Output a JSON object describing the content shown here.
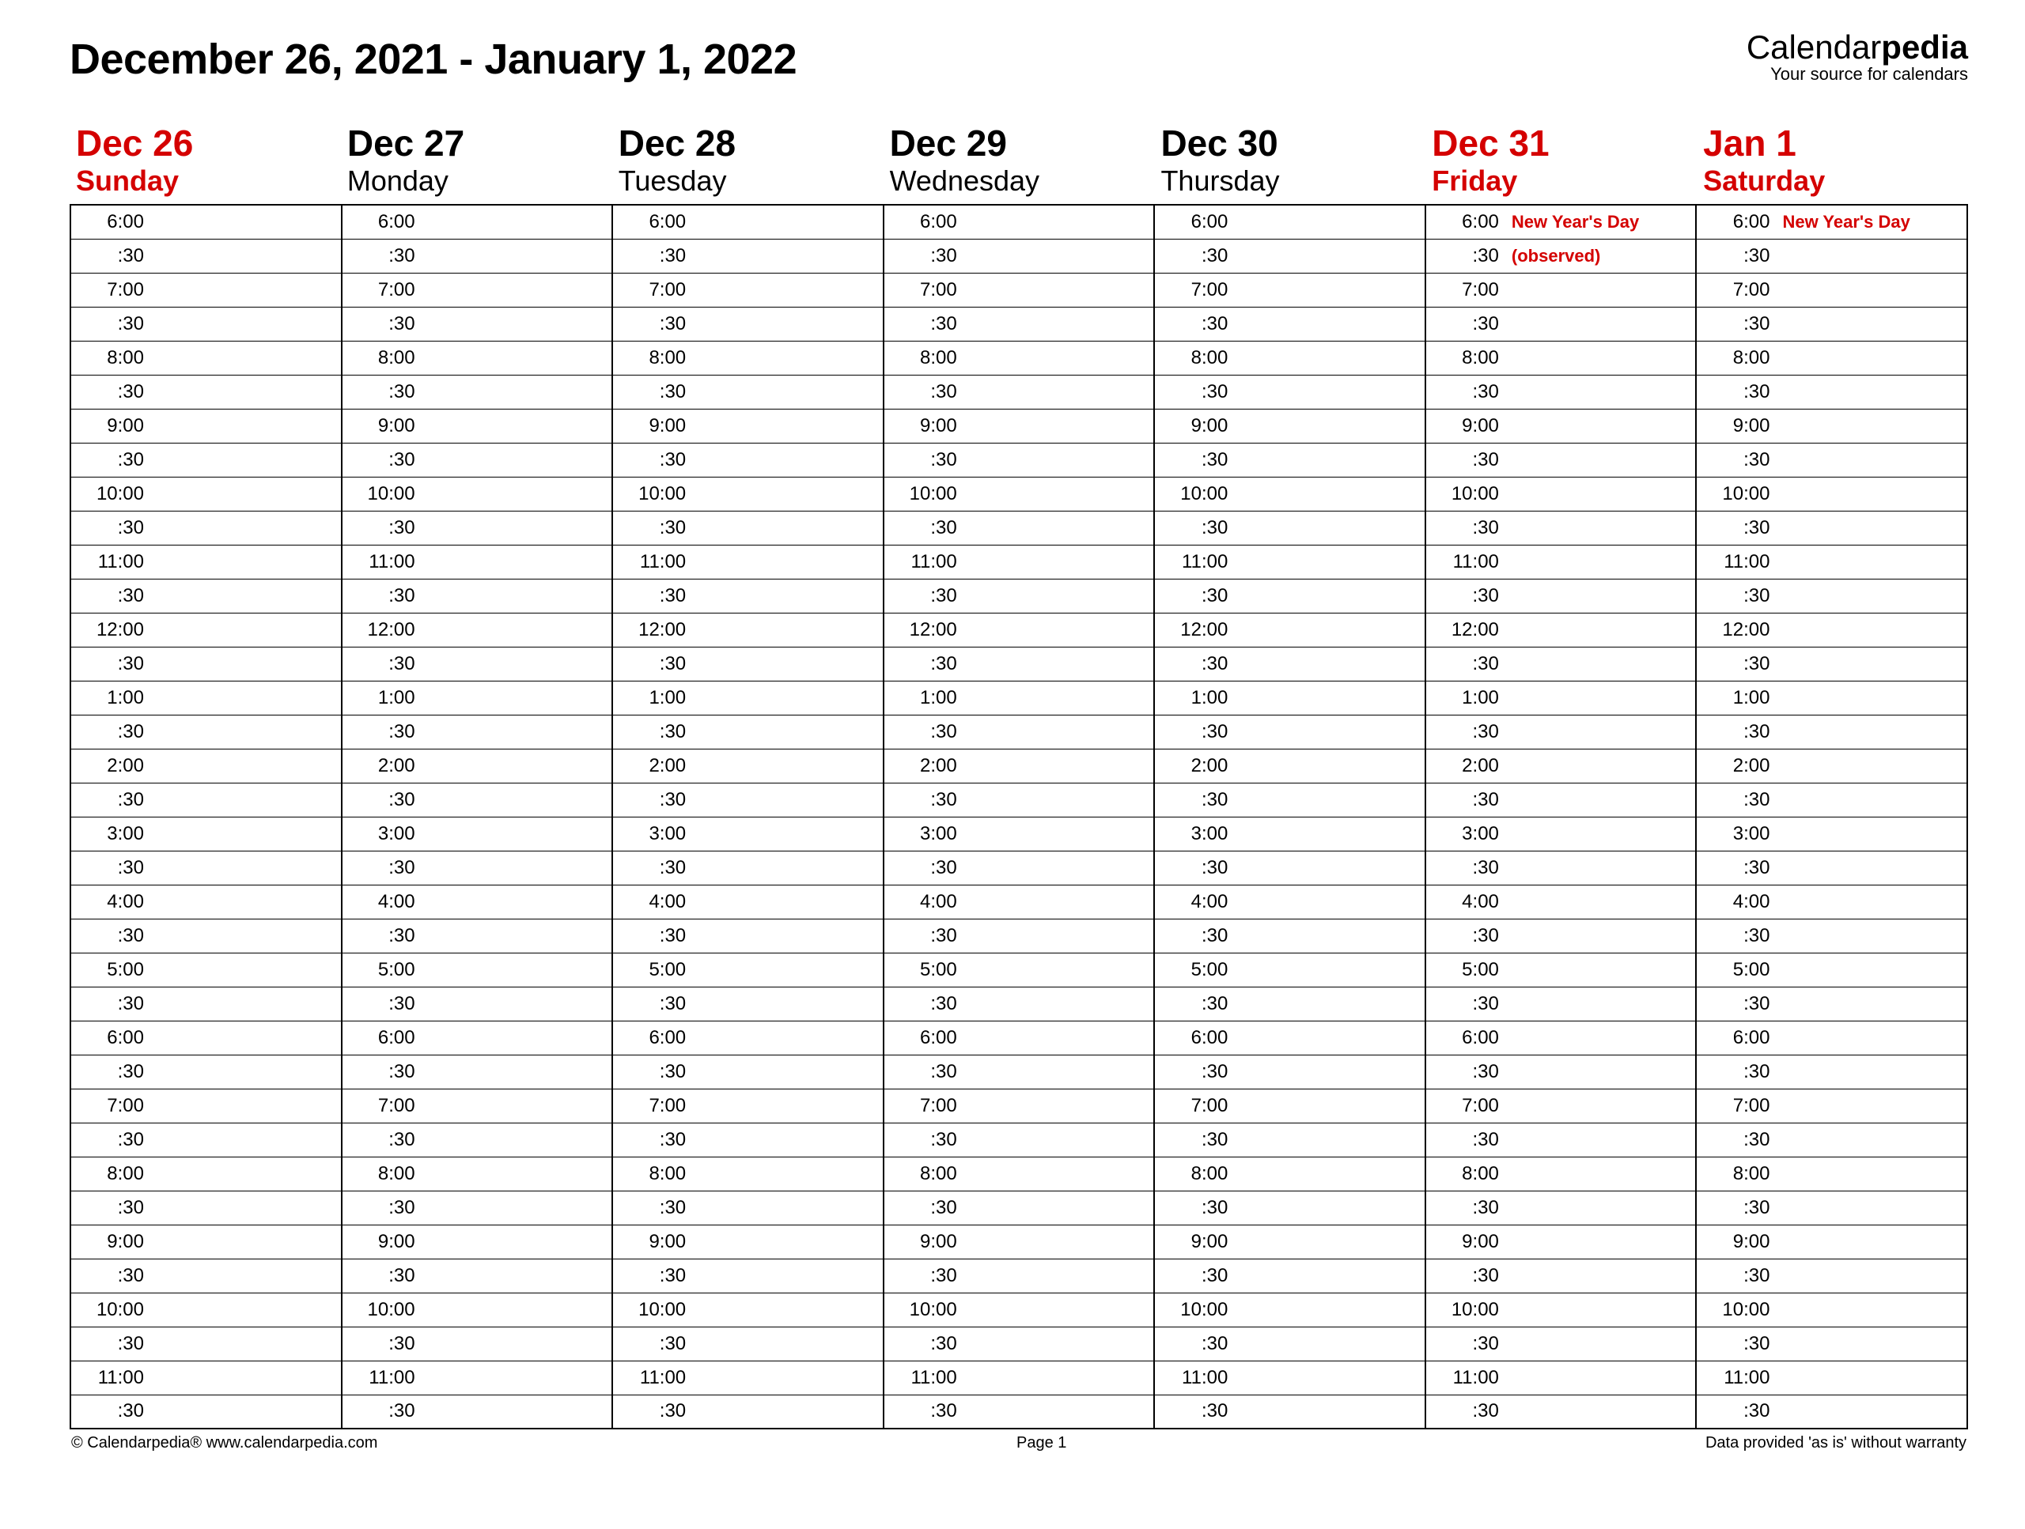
{
  "title": "December 26, 2021 - January 1, 2022",
  "brand": {
    "name_a": "Calendar",
    "name_b": "pedia",
    "tagline": "Your source for calendars"
  },
  "times": [
    "6:00",
    ":30",
    "7:00",
    ":30",
    "8:00",
    ":30",
    "9:00",
    ":30",
    "10:00",
    ":30",
    "11:00",
    ":30",
    "12:00",
    ":30",
    "1:00",
    ":30",
    "2:00",
    ":30",
    "3:00",
    ":30",
    "4:00",
    ":30",
    "5:00",
    ":30",
    "6:00",
    ":30",
    "7:00",
    ":30",
    "8:00",
    ":30",
    "9:00",
    ":30",
    "10:00",
    ":30",
    "11:00",
    ":30"
  ],
  "days": [
    {
      "date": "Dec 26",
      "dow": "Sunday",
      "weekend": true,
      "notes": {}
    },
    {
      "date": "Dec 27",
      "dow": "Monday",
      "weekend": false,
      "notes": {}
    },
    {
      "date": "Dec 28",
      "dow": "Tuesday",
      "weekend": false,
      "notes": {}
    },
    {
      "date": "Dec 29",
      "dow": "Wednesday",
      "weekend": false,
      "notes": {}
    },
    {
      "date": "Dec 30",
      "dow": "Thursday",
      "weekend": false,
      "notes": {}
    },
    {
      "date": "Dec 31",
      "dow": "Friday",
      "weekend": true,
      "notes": {
        "0": "New Year's Day",
        "1": "(observed)"
      }
    },
    {
      "date": "Jan 1",
      "dow": "Saturday",
      "weekend": true,
      "notes": {
        "0": "New Year's Day"
      }
    }
  ],
  "footer": {
    "left": "© Calendarpedia®   www.calendarpedia.com",
    "center": "Page 1",
    "right": "Data provided 'as is' without warranty"
  }
}
